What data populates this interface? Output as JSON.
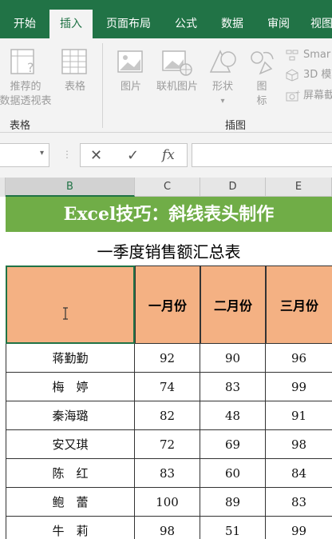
{
  "tabs": [
    "开始",
    "插入",
    "页面布局",
    "公式",
    "数据",
    "审阅",
    "视图"
  ],
  "active_tab_index": 1,
  "ribbon": {
    "pivot_label_1": "推荐的",
    "pivot_label_2": "数据透视表",
    "table_label": "表格",
    "group_tables": "表格",
    "picture_label": "图片",
    "online_picture_label": "联机图片",
    "shapes_label": "形状",
    "icons_label_1": "图",
    "icons_label_2": "标",
    "smartart_label": "Smar",
    "model3d_label": "3D 模",
    "screenshot_label": "屏幕截",
    "group_illustrations": "插图"
  },
  "formula_bar": {
    "name_box": "",
    "cancel_icon": "✕",
    "enter_icon": "✓",
    "fx_label": "fx",
    "formula": ""
  },
  "columns": [
    "B",
    "C",
    "D",
    "E"
  ],
  "selected_column": "B",
  "sheet": {
    "banner": "Excel技巧：斜线表头制作",
    "subtitle": "一季度销售额汇总表",
    "header_first": "",
    "months": [
      "一月份",
      "二月份",
      "三月份"
    ],
    "rows": [
      {
        "name": "蒋勤勤",
        "m1": "92",
        "m2": "90",
        "m3": "96"
      },
      {
        "name": "梅　婷",
        "m1": "74",
        "m2": "83",
        "m3": "99"
      },
      {
        "name": "秦海璐",
        "m1": "82",
        "m2": "48",
        "m3": "91"
      },
      {
        "name": "安又琪",
        "m1": "72",
        "m2": "69",
        "m3": "98"
      },
      {
        "name": "陈　红",
        "m1": "83",
        "m2": "60",
        "m3": "84"
      },
      {
        "name": "鲍　蕾",
        "m1": "100",
        "m2": "89",
        "m3": "83"
      },
      {
        "name": "牛　莉",
        "m1": "98",
        "m2": "51",
        "m3": "99"
      }
    ]
  },
  "colors": {
    "brand_green": "#217346",
    "banner_green": "#70ad47",
    "header_orange": "#f4b183"
  }
}
